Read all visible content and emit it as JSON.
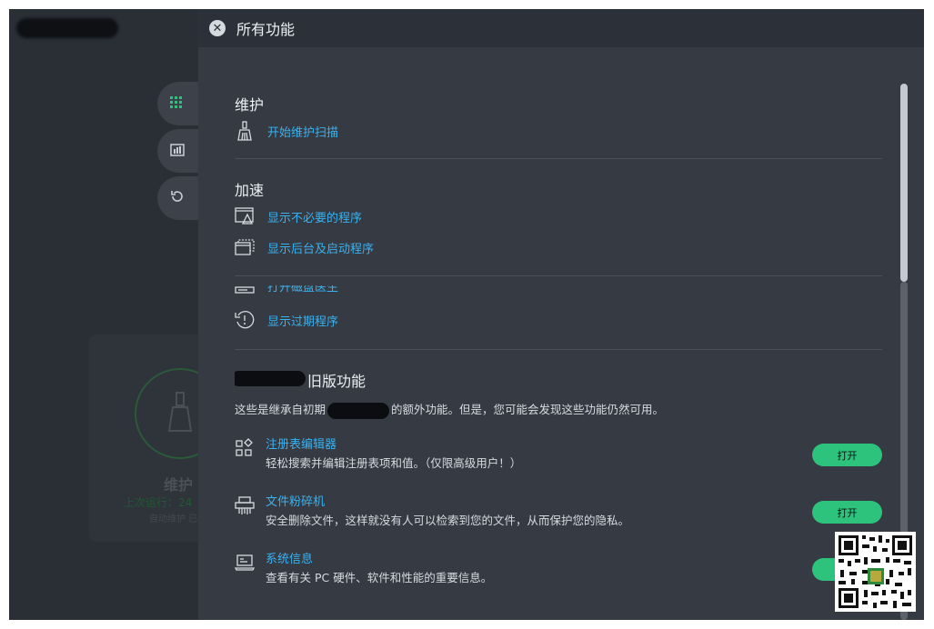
{
  "panel": {
    "title": "所有功能",
    "close_icon": "close-icon"
  },
  "sections": {
    "maintenance": {
      "title": "维护",
      "items": [
        {
          "label": "开始维护扫描",
          "icon": "broom-icon"
        }
      ]
    },
    "speedup": {
      "title": "加速",
      "items": [
        {
          "label": "显示不必要的程序",
          "icon": "window-warning-icon"
        },
        {
          "label": "显示后台及启动程序",
          "icon": "windows-stack-icon"
        },
        {
          "label": "打开磁盘医生",
          "icon": "disk-icon"
        },
        {
          "label": "显示过期程序",
          "icon": "outdated-icon"
        }
      ]
    },
    "legacy": {
      "title": "旧版功能",
      "desc_prefix": "这些是继承自初期",
      "desc_suffix": "的额外功能。但是，您可能会发现这些功能仍然可用。",
      "items": [
        {
          "name": "注册表编辑器",
          "desc": "轻松搜索并编辑注册表项和值。（仅限高级用户！）",
          "button": "打开",
          "icon": "registry-icon"
        },
        {
          "name": "文件粉碎机",
          "desc": "安全删除文件，这样就没有人可以检索到您的文件，从而保护您的隐私。",
          "button": "打开",
          "icon": "shredder-icon"
        },
        {
          "name": "系统信息",
          "desc": "查看有关 PC 硬件、软件和性能的重要信息。",
          "button": "",
          "icon": "system-info-icon"
        }
      ]
    }
  },
  "background": {
    "card_title": "维护",
    "card_sub": "上次运行：24",
    "card_sub2": "自动维护 已",
    "side_buttons": [
      "grid-icon",
      "chart-icon",
      "history-icon"
    ]
  },
  "colors": {
    "link": "#38b2f0",
    "button": "#2ec37c",
    "panel_bg": "#353a43"
  }
}
